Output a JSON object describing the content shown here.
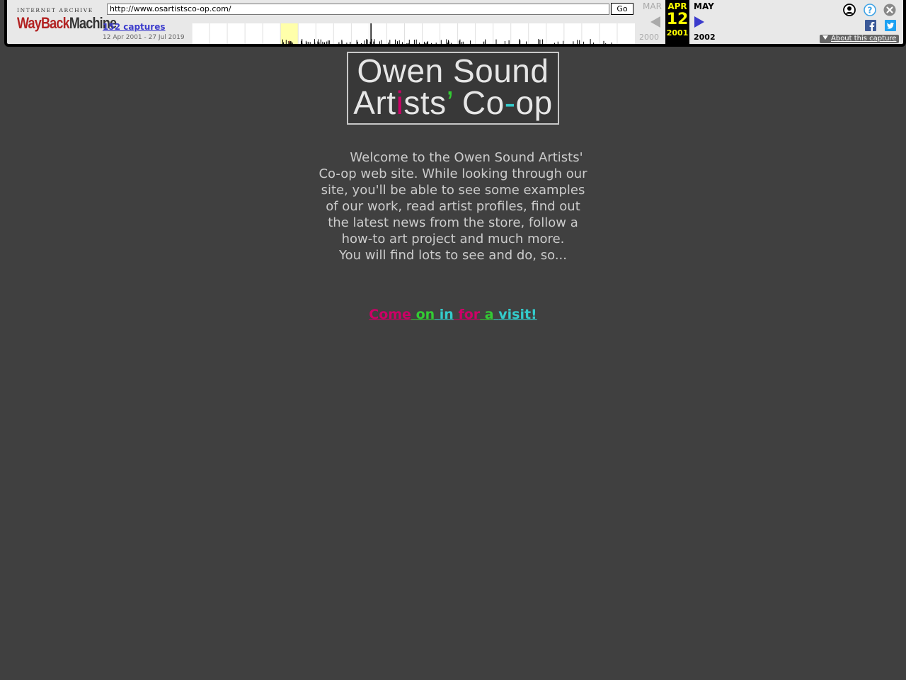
{
  "wayback": {
    "logo_top": "INTERNET ARCHIVE",
    "logo_way": "WayBack",
    "logo_machine": "Machine",
    "url": "http://www.osartistsco-op.com/",
    "go_label": "Go",
    "captures_label": "152 captures",
    "captures_range": "12 Apr 2001 - 27 Jul 2019",
    "prev_month": "MAR",
    "current_month": "APR",
    "next_month": "MAY",
    "current_day": "12",
    "prev_year": "2000",
    "current_year": "2001",
    "next_year": "2002",
    "about_label": "About this capture",
    "colors": {
      "current_bg": "#000000",
      "current_fg": "#ffff00",
      "link": "#3c3ccc",
      "highlight": "#ffffaa"
    },
    "icons": [
      "account-icon",
      "help-icon",
      "close-icon",
      "facebook-icon",
      "twitter-icon"
    ],
    "sparkline_years": [
      "1996",
      "1997",
      "1998",
      "1999",
      "2000",
      "2001",
      "2002",
      "2003",
      "2004",
      "2005",
      "2006",
      "2007",
      "2008",
      "2009",
      "2010",
      "2011",
      "2012",
      "2013",
      "2014",
      "2015",
      "2016",
      "2017",
      "2018",
      "2019",
      "2020"
    ],
    "sparkline_highlight_year": "2001"
  },
  "site": {
    "logo_line1": "Owen Sound",
    "logo_line2_a": "Art",
    "logo_line2_i": "i",
    "logo_line2_b": "sts",
    "logo_line2_apos": "’",
    "logo_line2_c": " Co",
    "logo_line2_dash": "-",
    "logo_line2_d": "op",
    "welcome_line1": "Welcome to the Owen Sound Artists'",
    "welcome_line2": "Co-op web site. While looking through our",
    "welcome_line3": "site, you'll be able to see some examples",
    "welcome_line4": "of our work, read artist profiles, find out",
    "welcome_line5": "the latest news from the store, follow a",
    "welcome_line6": "how-to art project and much more.",
    "welcome_line7": "You will find lots to see and do, so...",
    "visit_words": [
      "Come",
      "on",
      "in",
      "for",
      "a",
      "visit!"
    ],
    "colors": {
      "background": "#404040",
      "pink": "#cc0066",
      "green": "#33cc33",
      "cyan": "#33cccc",
      "text": "#cccccc"
    }
  }
}
